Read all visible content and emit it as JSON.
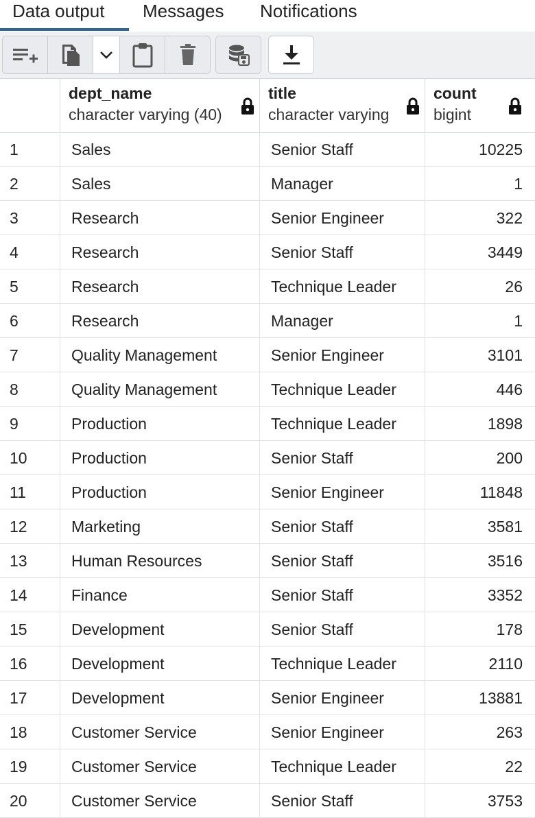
{
  "tabs": [
    {
      "label": "Data output",
      "active": true
    },
    {
      "label": "Messages",
      "active": false
    },
    {
      "label": "Notifications",
      "active": false
    }
  ],
  "toolbar": {
    "buttons": [
      {
        "icon": "add-row-icon"
      },
      {
        "icon": "copy-icon"
      },
      {
        "icon": "chevron-down-icon"
      },
      {
        "icon": "paste-icon"
      },
      {
        "icon": "delete-icon"
      },
      {
        "icon": "save-data-icon"
      },
      {
        "icon": "download-icon"
      }
    ]
  },
  "columns": [
    {
      "name": "dept_name",
      "type": "character varying (40)",
      "locked": true
    },
    {
      "name": "title",
      "type": "character varying",
      "locked": true
    },
    {
      "name": "count",
      "type": "bigint",
      "locked": true
    }
  ],
  "rows": [
    {
      "n": "1",
      "dept_name": "Sales",
      "title": "Senior Staff",
      "count": "10225"
    },
    {
      "n": "2",
      "dept_name": "Sales",
      "title": "Manager",
      "count": "1"
    },
    {
      "n": "3",
      "dept_name": "Research",
      "title": "Senior Engineer",
      "count": "322"
    },
    {
      "n": "4",
      "dept_name": "Research",
      "title": "Senior Staff",
      "count": "3449"
    },
    {
      "n": "5",
      "dept_name": "Research",
      "title": "Technique Leader",
      "count": "26"
    },
    {
      "n": "6",
      "dept_name": "Research",
      "title": "Manager",
      "count": "1"
    },
    {
      "n": "7",
      "dept_name": "Quality Management",
      "title": "Senior Engineer",
      "count": "3101"
    },
    {
      "n": "8",
      "dept_name": "Quality Management",
      "title": "Technique Leader",
      "count": "446"
    },
    {
      "n": "9",
      "dept_name": "Production",
      "title": "Technique Leader",
      "count": "1898"
    },
    {
      "n": "10",
      "dept_name": "Production",
      "title": "Senior Staff",
      "count": "200"
    },
    {
      "n": "11",
      "dept_name": "Production",
      "title": "Senior Engineer",
      "count": "11848"
    },
    {
      "n": "12",
      "dept_name": "Marketing",
      "title": "Senior Staff",
      "count": "3581"
    },
    {
      "n": "13",
      "dept_name": "Human Resources",
      "title": "Senior Staff",
      "count": "3516"
    },
    {
      "n": "14",
      "dept_name": "Finance",
      "title": "Senior Staff",
      "count": "3352"
    },
    {
      "n": "15",
      "dept_name": "Development",
      "title": "Senior Staff",
      "count": "178"
    },
    {
      "n": "16",
      "dept_name": "Development",
      "title": "Technique Leader",
      "count": "2110"
    },
    {
      "n": "17",
      "dept_name": "Development",
      "title": "Senior Engineer",
      "count": "13881"
    },
    {
      "n": "18",
      "dept_name": "Customer Service",
      "title": "Senior Engineer",
      "count": "263"
    },
    {
      "n": "19",
      "dept_name": "Customer Service",
      "title": "Technique Leader",
      "count": "22"
    },
    {
      "n": "20",
      "dept_name": "Customer Service",
      "title": "Senior Staff",
      "count": "3753"
    }
  ]
}
